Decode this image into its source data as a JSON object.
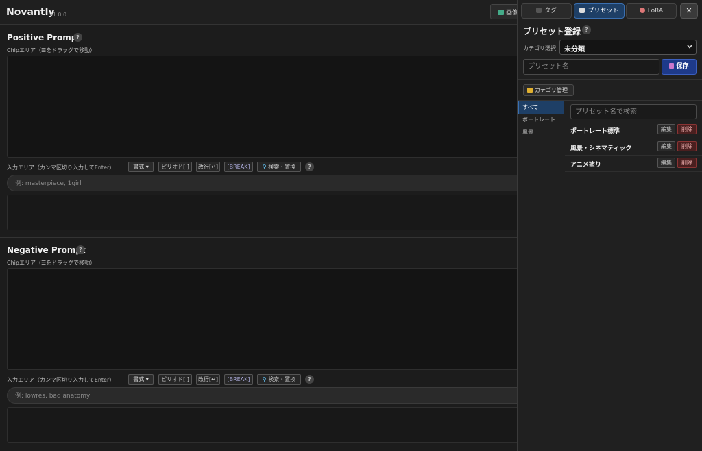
{
  "app": {
    "title": "Novantly",
    "version": "v1.0.0",
    "header_button_label": "画像"
  },
  "positive": {
    "title": "Positive Prompt",
    "chip_label": "Chipエリア（☰をドラッグで移動）",
    "input_label": "入力エリア（カンマ区切り入力してEnter）",
    "format_btn": "書式 ▾",
    "period_btn": "ピリオド[.]",
    "newline_btn": "改行[↵]",
    "break_btn": "[BREAK]",
    "search_btn": "検索・置換",
    "placeholder": "例: masterpiece, 1girl"
  },
  "negative": {
    "title": "Negative Prompt",
    "chip_label": "Chipエリア（☰をドラッグで移動）",
    "input_label": "入力エリア（カンマ区切り入力してEnter）",
    "format_btn": "書式 ▾",
    "period_btn": "ピリオド[.]",
    "newline_btn": "改行[↵]",
    "break_btn": "[BREAK]",
    "search_btn": "検索・置換",
    "placeholder": "例: lowres, bad anatomy"
  },
  "help_glyph": "?",
  "panel": {
    "tabs": [
      {
        "label": "タグ",
        "active": false
      },
      {
        "label": "プリセット",
        "active": true
      },
      {
        "label": "LoRA",
        "active": false
      }
    ],
    "close_label": "✕",
    "title": "プリセット登録",
    "category_label": "カテゴリ選択",
    "category_value": "未分類",
    "name_placeholder": "プリセット名",
    "save_label": "保存",
    "category_manage_label": "カテゴリ管理",
    "categories": [
      "すべて",
      "ポートレート",
      "風景"
    ],
    "search_placeholder": "プリセット名で検索",
    "presets": [
      "ポートレート標準",
      "風景・シネマティック",
      "アニメ塗り"
    ],
    "edit_label": "編集",
    "delete_label": "削除"
  },
  "colors": {
    "accent": "#1e3f66",
    "save": "#1e3a8a",
    "danger": "#4a1f1f"
  }
}
